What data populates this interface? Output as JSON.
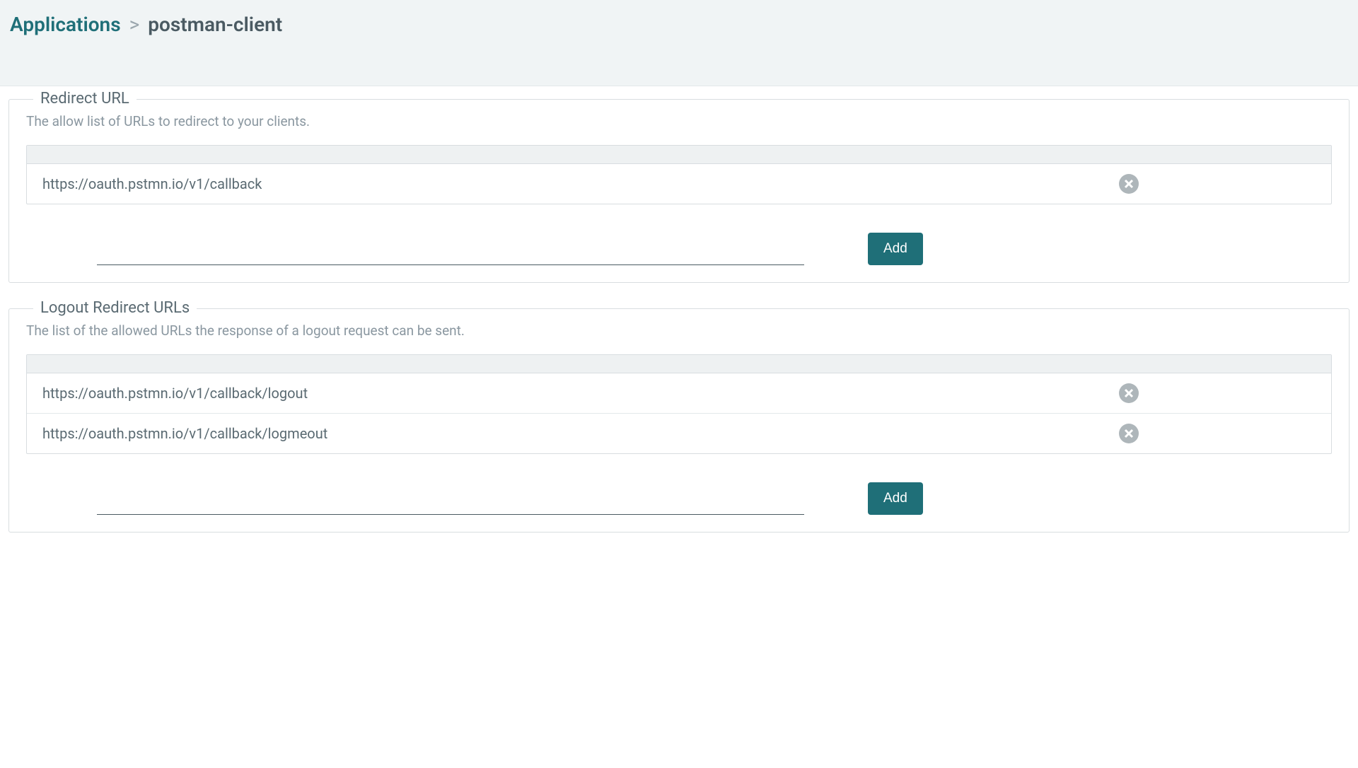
{
  "breadcrumb": {
    "root": "Applications",
    "separator": ">",
    "current": "postman-client"
  },
  "sections": {
    "redirect": {
      "legend": "Redirect URL",
      "description": "The allow list of URLs to redirect to your clients.",
      "urls": [
        "https://oauth.pstmn.io/v1/callback"
      ],
      "add_label": "Add"
    },
    "logout": {
      "legend": "Logout Redirect URLs",
      "description": "The list of the allowed URLs the response of a logout request can be sent.",
      "urls": [
        "https://oauth.pstmn.io/v1/callback/logout",
        "https://oauth.pstmn.io/v1/callback/logmeout"
      ],
      "add_label": "Add"
    }
  }
}
